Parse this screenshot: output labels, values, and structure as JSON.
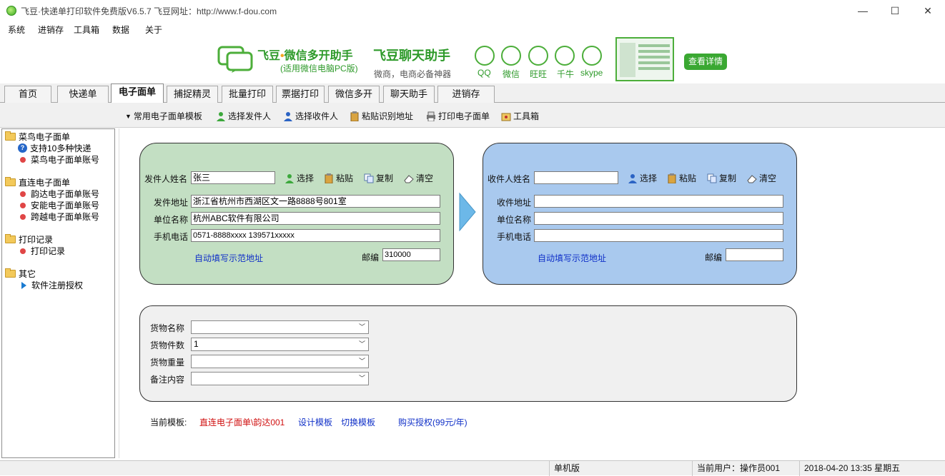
{
  "window": {
    "title": "飞豆·快递单打印软件免费版V6.5.7   飞豆网址：http://www.f-dou.com",
    "minimize": "—",
    "maximize": "☐",
    "close": "✕"
  },
  "menu": [
    "系统",
    "进销存",
    "工具箱",
    "数据",
    "关于"
  ],
  "banner": {
    "product_name": "飞豆",
    "product_dot": "•",
    "product_rest": "微信多开助手",
    "product_sub": "(适用微信电脑PC版)",
    "chat_title": "飞豆聊天助手",
    "chat_sub": "微商，电商必备神器",
    "apps": [
      "QQ",
      "微信",
      "旺旺",
      "千牛",
      "skype"
    ],
    "details_button": "查看详情"
  },
  "tabs": [
    {
      "label": "首页",
      "active": false
    },
    {
      "label": "快递单",
      "active": false
    },
    {
      "label": "电子面单",
      "active": true
    },
    {
      "label": "捕捉精灵",
      "active": false
    },
    {
      "label": "批量打印",
      "active": false
    },
    {
      "label": "票据打印",
      "active": false
    },
    {
      "label": "微信多开",
      "active": false
    },
    {
      "label": "聊天助手",
      "active": false
    },
    {
      "label": "进销存",
      "active": false
    }
  ],
  "toolbar": {
    "templates": "常用电子面单模板",
    "select_sender": "选择发件人",
    "select_receiver": "选择收件人",
    "paste_recognize": "粘贴识别地址",
    "print": "打印电子面单",
    "toolbox": "工具箱"
  },
  "tree": {
    "cainiao": "菜鸟电子面单",
    "cainiao_support": "支持10多种快递",
    "cainiao_account": "菜鸟电子面单账号",
    "direct": "直连电子面单",
    "yunda": "韵达电子面单账号",
    "anneng": "安能电子面单账号",
    "kuayue": "跨越电子面单账号",
    "print_records": "打印记录",
    "print_records_item": "打印记录",
    "other": "其它",
    "register": "软件注册授权"
  },
  "sender": {
    "name_label": "发件人姓名",
    "name_value": "张三",
    "address_label": "发件地址",
    "address_value": "浙江省杭州市西湖区文一路8888号801室",
    "company_label": "单位名称",
    "company_value": "杭州ABC软件有限公司",
    "phone_label": "手机电话",
    "phone_value": "0571-8888xxxx  139571xxxxx",
    "auto_fill": "自动填写示范地址",
    "zip_label": "邮编",
    "zip_value": "310000"
  },
  "receiver": {
    "name_label": "收件人姓名",
    "name_value": "",
    "address_label": "收件地址",
    "address_value": "",
    "company_label": "单位名称",
    "company_value": "",
    "phone_label": "手机电话",
    "phone_value": "",
    "auto_fill": "自动填写示范地址",
    "zip_label": "邮编",
    "zip_value": ""
  },
  "actions": {
    "select": "选择",
    "paste": "粘贴",
    "copy": "复制",
    "clear": "清空"
  },
  "goods": {
    "name_label": "货物名称",
    "name_value": "",
    "count_label": "货物件数",
    "count_value": "1",
    "weight_label": "货物重量",
    "weight_value": "",
    "remark_label": "备注内容",
    "remark_value": ""
  },
  "template_bar": {
    "current_label": "当前模板:",
    "current_value": "直连电子面单\\韵达001",
    "design": "设计模板",
    "switch": "切换模板",
    "buy": "购买授权(99元/年)"
  },
  "status": {
    "mode": "单机版",
    "user": "当前用户：操作员001",
    "datetime": "2018-04-20 13:35 星期五"
  }
}
